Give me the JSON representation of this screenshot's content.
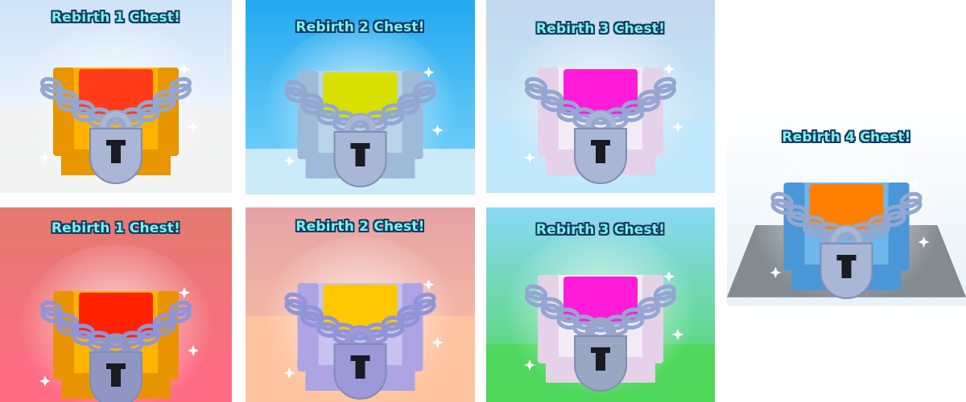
{
  "tiles": [
    {
      "id": "r1a",
      "title": "Rebirth 1 Chest!",
      "bg_top": "#cfe3f7",
      "bg_bottom": "#ffffff",
      "floor": "#f2f2f2",
      "lid": "#ff3b1a",
      "body": "#ffb300",
      "body_dark": "#e89500",
      "chain": "#93a7d0",
      "lock": "#a9b6d6"
    },
    {
      "id": "r2a",
      "title": "Rebirth 2 Chest!",
      "bg_top": "#22a9f0",
      "bg_bottom": "#7fd6fb",
      "floor": "#d4edf7",
      "lid": "#d7e000",
      "body": "#b9d3ea",
      "body_dark": "#9dbbd8",
      "chain": "#93a7d0",
      "lock": "#a9b6d6"
    },
    {
      "id": "r3a",
      "title": "Rebirth 3 Chest!",
      "bg_top": "#c3d7ee",
      "bg_bottom": "#c8f0ff",
      "floor": "#bfe7fb",
      "lid": "#ff1bd8",
      "body": "#f4ecf5",
      "body_dark": "#e6d2e8",
      "chain": "#93a7d0",
      "lock": "#a9b6d6"
    },
    {
      "id": "r1b",
      "title": "Rebirth 1 Chest!",
      "bg_top": "#e57a70",
      "bg_bottom": "#ff6d85",
      "floor": "#ff6d85",
      "lid": "#ff2200",
      "body": "#ffb400",
      "body_dark": "#e89400",
      "chain": "#8f95d8",
      "lock": "#8f96c4"
    },
    {
      "id": "r2b",
      "title": "Rebirth 2 Chest!",
      "bg_top": "#e6a2a5",
      "bg_bottom": "#ffc6a5",
      "floor": "#ffc39f",
      "lid": "#ffc800",
      "body": "#c8c2f0",
      "body_dark": "#aea4e3",
      "chain": "#8f95d8",
      "lock": "#9d98d8"
    },
    {
      "id": "r3b",
      "title": "Rebirth 3 Chest!",
      "bg_top": "#8ad9f5",
      "bg_bottom": "#4ed75a",
      "floor": "#4ed75a",
      "lid": "#ff1bd8",
      "body": "#f4ecf5",
      "body_dark": "#e6d2e8",
      "chain": "#93a7d0",
      "lock": "#9aa6c4"
    },
    {
      "id": "r4",
      "title": "Rebirth 4 Chest!",
      "bg_top": "#ffffff",
      "bg_bottom": "#e7f2f8",
      "floor": "#838a90",
      "lid": "#ff7f00",
      "body": "#6fb7ea",
      "body_dark": "#4a97d7",
      "chain": "#93a7d0",
      "lock": "#a9b6d6"
    }
  ]
}
